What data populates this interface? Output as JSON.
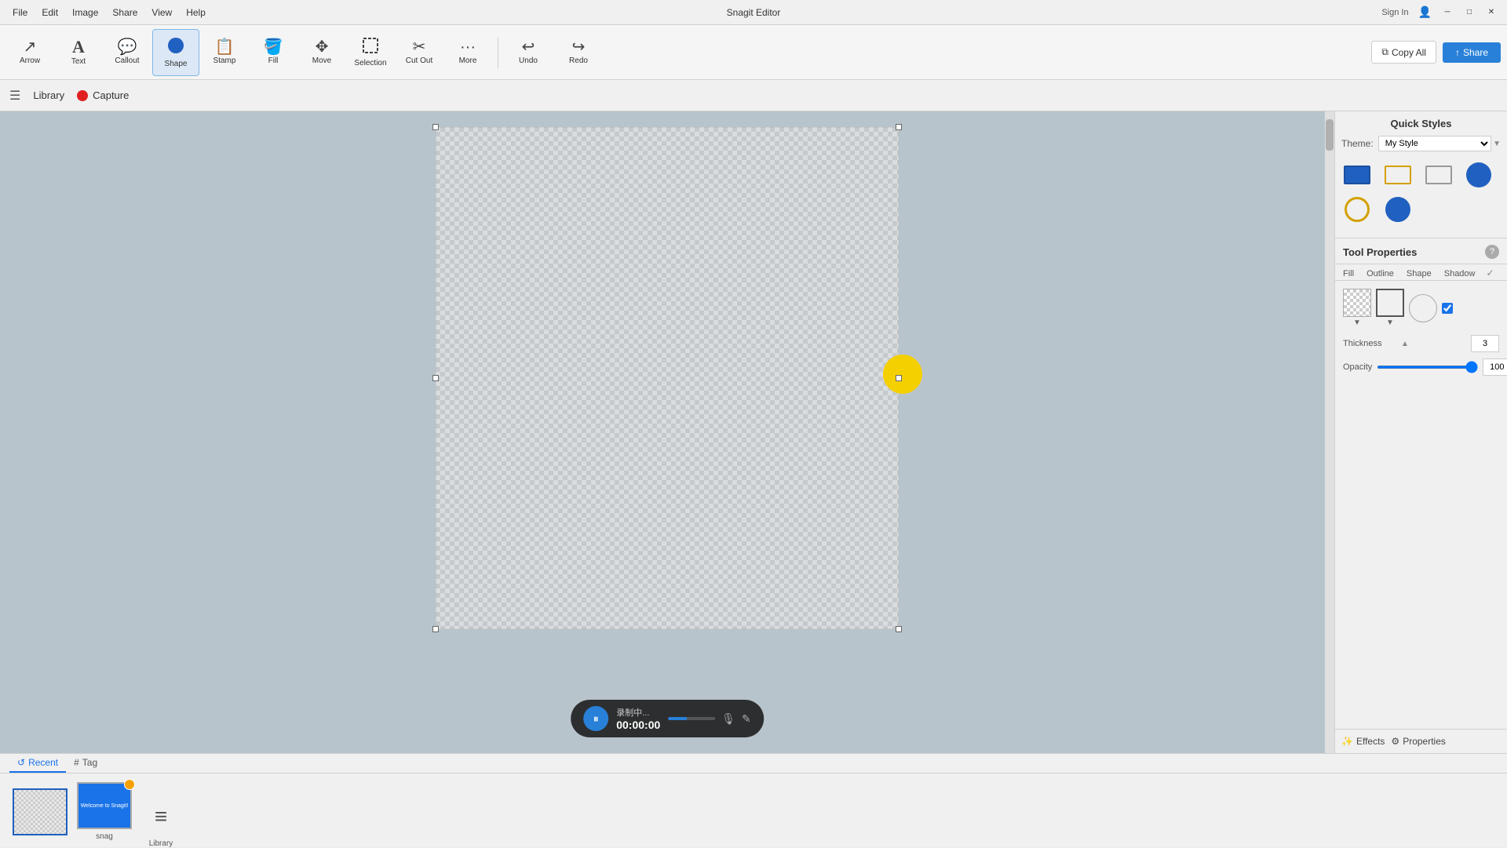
{
  "titleBar": {
    "title": "Snagit Editor",
    "menus": [
      "File",
      "Edit",
      "Image",
      "Share",
      "View",
      "Help"
    ],
    "signIn": "Sign In",
    "winButtons": [
      "minimize",
      "maximize",
      "close"
    ]
  },
  "toolbar": {
    "tools": [
      {
        "id": "arrow",
        "label": "Arrow",
        "icon": "↗"
      },
      {
        "id": "text",
        "label": "Text",
        "icon": "A"
      },
      {
        "id": "callout",
        "label": "Callout",
        "icon": "💬"
      },
      {
        "id": "shape",
        "label": "Shape",
        "icon": "⬟"
      },
      {
        "id": "stamp",
        "label": "Stamp",
        "icon": "🖹"
      },
      {
        "id": "fill",
        "label": "Fill",
        "icon": "🪣"
      },
      {
        "id": "move",
        "label": "Move",
        "icon": "✥"
      },
      {
        "id": "selection",
        "label": "Selection",
        "icon": "⬚"
      },
      {
        "id": "cutout",
        "label": "Cut Out",
        "icon": "✂"
      }
    ],
    "more": "More",
    "undo": "Undo",
    "redo": "Redo",
    "copyAll": "Copy All",
    "share": "Share"
  },
  "navBar": {
    "library": "Library",
    "capture": "Capture"
  },
  "rightPanel": {
    "quickStyles": {
      "title": "Quick Styles",
      "themeLabel": "Theme:",
      "themeValue": "My Style",
      "styles": [
        "blue-filled-rect",
        "yellow-outline-rect",
        "gray-outline-rect",
        "blue-circle-filled",
        "yellow-circle-outline",
        "blue-circle-solid"
      ]
    },
    "toolProperties": {
      "title": "Tool Properties",
      "helpIcon": "?",
      "tabs": [
        "Fill",
        "Outline",
        "Shape",
        "Shadow"
      ],
      "thickness": {
        "label": "Thickness",
        "infoIcon": "▲",
        "value": "3"
      },
      "opacity": {
        "label": "Opacity",
        "value": "100"
      }
    },
    "bottomButtons": {
      "effects": "Effects",
      "properties": "Properties"
    }
  },
  "bottomPanel": {
    "tabs": [
      {
        "id": "recent",
        "label": "Recent",
        "icon": "↺"
      },
      {
        "id": "tag",
        "label": "Tag",
        "icon": "#"
      }
    ],
    "thumbnails": [
      {
        "id": "blank",
        "label": "",
        "type": "blank",
        "selected": true
      },
      {
        "id": "snag",
        "label": "snag",
        "type": "snag",
        "hasBadge": true
      }
    ],
    "library": {
      "label": "Library",
      "icon": "≡"
    }
  },
  "recording": {
    "status": "录制中...",
    "time": "00:00:00",
    "pauseIcon": "⏸",
    "micIcon": "🎙",
    "editIcon": "✎"
  }
}
